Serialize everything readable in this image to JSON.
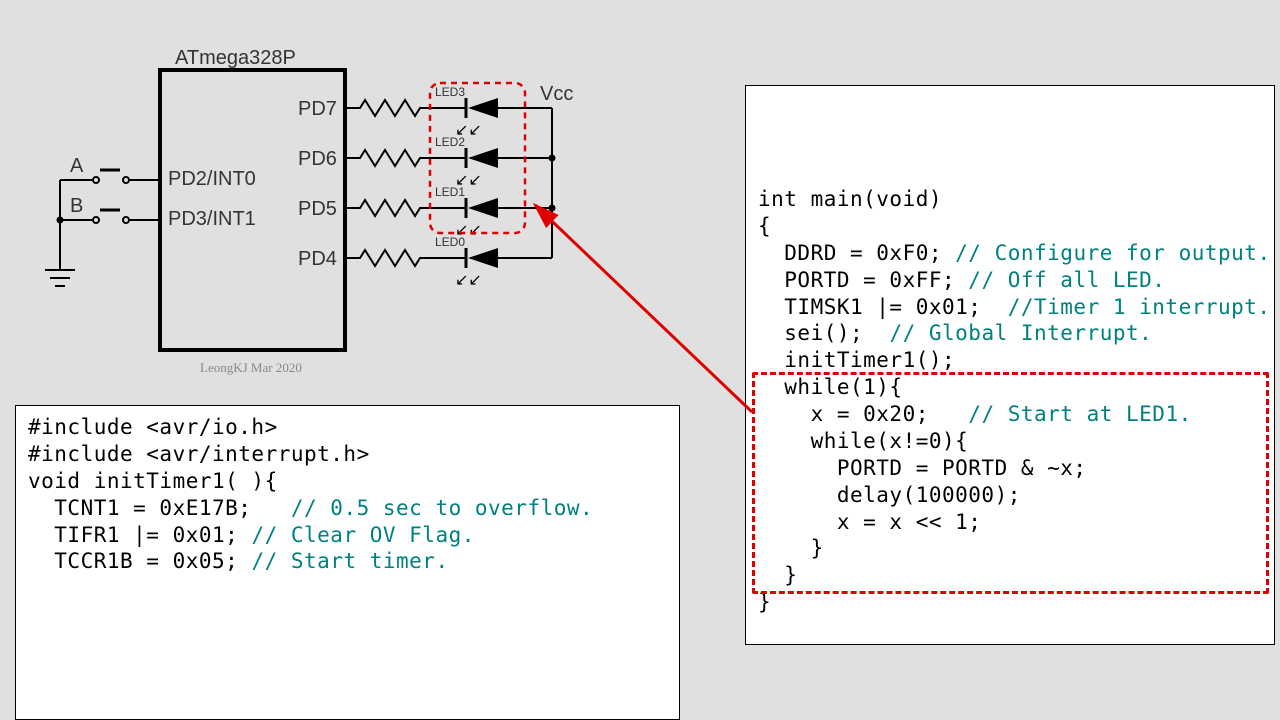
{
  "schematic": {
    "mcu": "ATmega328P",
    "left_pins": [
      "PD2/INT0",
      "PD3/INT1"
    ],
    "right_pins": [
      "PD7",
      "PD6",
      "PD5",
      "PD4"
    ],
    "leds": [
      "LED3",
      "LED2",
      "LED1",
      "LED0"
    ],
    "buttons": [
      "A",
      "B"
    ],
    "vcc": "Vcc",
    "credit": "LeongKJ Mar 2020",
    "highlight_leds": [
      "LED3",
      "LED2",
      "LED1"
    ]
  },
  "code_left": {
    "lines": [
      {
        "t": "#include <avr/io.h>"
      },
      {
        "t": "#include <avr/interrupt.h>"
      },
      {
        "t": ""
      },
      {
        "t": ""
      },
      {
        "t": ""
      },
      {
        "t": ""
      },
      {
        "t": ""
      },
      {
        "t": "void initTimer1( ){"
      },
      {
        "t": "  TCNT1 = 0xE17B;   ",
        "c": "// 0.5 sec to overflow."
      },
      {
        "t": "  TIFR1 |= 0x01; ",
        "c": "// Clear OV Flag."
      },
      {
        "t": "  TCCR1B = 0x05; ",
        "c": "// Start timer."
      }
    ]
  },
  "code_right": {
    "lines": [
      {
        "t": "int main(void)"
      },
      {
        "t": "{"
      },
      {
        "t": "  DDRD = 0xF0; ",
        "c": "// Configure for output."
      },
      {
        "t": "  PORTD = 0xFF; ",
        "c": "// Off all LED."
      },
      {
        "t": "  TIMSK1 |= 0x01;  ",
        "c": "//Timer 1 interrupt."
      },
      {
        "t": "  sei();  ",
        "c": "// Global Interrupt."
      },
      {
        "t": "  initTimer1();"
      },
      {
        "t": "  while(1){"
      },
      {
        "t": "    x = 0x20;   ",
        "c": "// Start at LED1."
      },
      {
        "t": "    while(x!=0){"
      },
      {
        "t": "      PORTD = PORTD & ~x;"
      },
      {
        "t": "      delay(100000);"
      },
      {
        "t": "      x = x << 1;"
      },
      {
        "t": "    }"
      },
      {
        "t": "  }"
      },
      {
        "t": "}"
      }
    ],
    "highlight_range": [
      7,
      14
    ]
  }
}
